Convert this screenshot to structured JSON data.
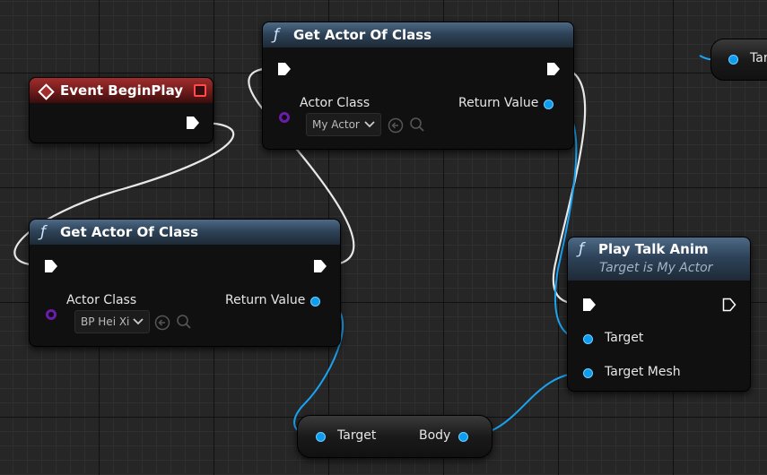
{
  "nodes": {
    "event_begin_play": {
      "title": "Event BeginPlay"
    },
    "get_actor_top": {
      "title": "Get Actor Of Class",
      "actor_class_label": "Actor Class",
      "actor_class_value": "My Actor",
      "return_label": "Return Value"
    },
    "get_actor_left": {
      "title": "Get Actor Of Class",
      "actor_class_label": "Actor Class",
      "actor_class_value": "BP Hei Xi",
      "return_label": "Return Value"
    },
    "play_talk_anim": {
      "title": "Play Talk Anim",
      "subtitle": "Target is My Actor",
      "target_label": "Target",
      "target_mesh_label": "Target Mesh"
    },
    "body_getter": {
      "target_label": "Target",
      "body_label": "Body"
    },
    "partial_right": {
      "label": "Tar"
    }
  },
  "icons": {
    "function": "function-icon",
    "event": "event-diamond-icon",
    "stop": "stop-icon",
    "use_selected": "use-selected-arrow-icon",
    "browse": "magnifier-icon"
  },
  "colors": {
    "exec_wire": "#e8e8e8",
    "data_wire": "#1aa3f0",
    "class_pin": "#6a1ea8",
    "function_header": "#2e4359",
    "event_header": "#8a2222"
  }
}
